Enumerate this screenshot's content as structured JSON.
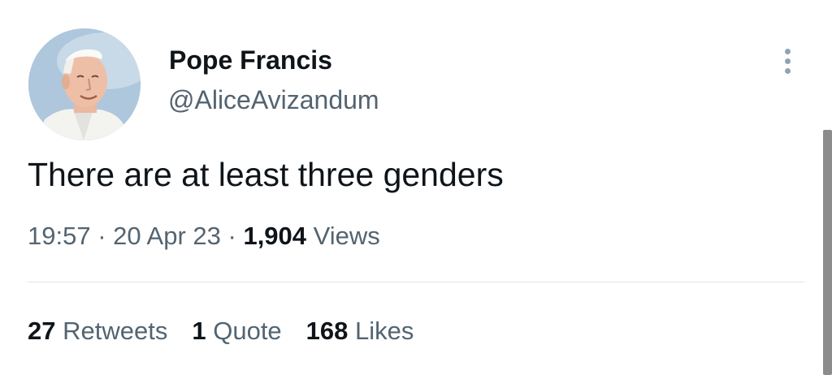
{
  "tweet": {
    "display_name": "Pope Francis",
    "handle": "@AliceAvizandum",
    "text": "There are at least three genders",
    "time": "19:57",
    "date": "20 Apr 23",
    "separator": "·",
    "views_count": "1,904",
    "views_label": "Views"
  },
  "stats": {
    "retweets_count": "27",
    "retweets_label": "Retweets",
    "quotes_count": "1",
    "quotes_label": "Quote",
    "likes_count": "168",
    "likes_label": "Likes"
  },
  "icons": {
    "more": "more-vertical-icon"
  },
  "colors": {
    "primary_text": "#0f1419",
    "secondary_text": "#536471",
    "divider": "#e1e6ea",
    "avatar_background": "#aec7dc"
  }
}
